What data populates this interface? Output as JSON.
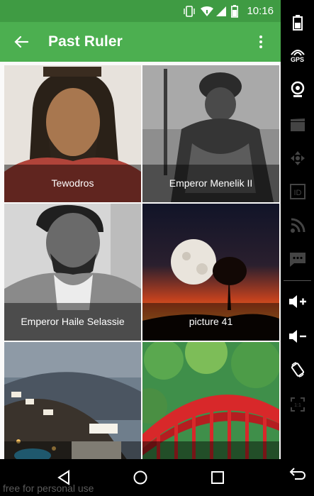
{
  "status_bar": {
    "time": "10:16"
  },
  "app_bar": {
    "title": "Past Ruler"
  },
  "tiles": [
    {
      "caption": "Tewodros"
    },
    {
      "caption": "Emperor Menelik II"
    },
    {
      "caption": "Emperor Haile Selassie"
    },
    {
      "caption": "picture 41"
    },
    {
      "caption": ""
    },
    {
      "caption": ""
    }
  ],
  "side_panel": {
    "gps_label": "GPS"
  },
  "watermark": "free for personal use",
  "colors": {
    "status_bar": "#3f9b43",
    "app_bar": "#4caf50",
    "caption_overlay": "rgba(0,0,0,0.45)"
  },
  "icons": [
    "battery-icon",
    "gps-icon",
    "webcam-icon",
    "clapper-icon",
    "move-icon",
    "id-icon",
    "rss-icon",
    "sms-icon",
    "volume-up-icon",
    "volume-down-icon",
    "rotate-icon",
    "scale-icon",
    "back-icon",
    "home-icon",
    "recents-icon",
    "sidebar-back-icon"
  ]
}
